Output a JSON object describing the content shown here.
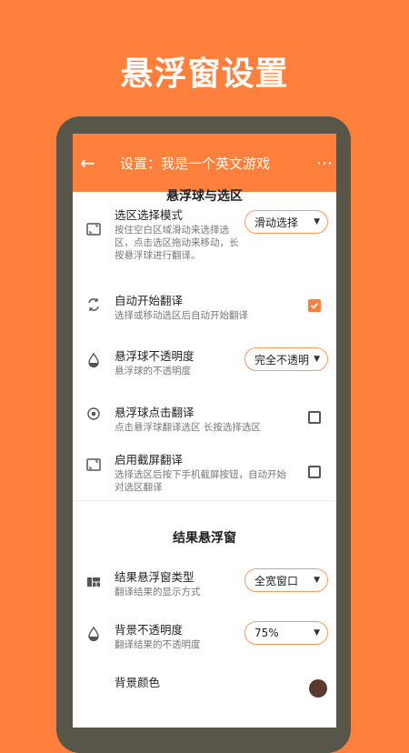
{
  "promo_title": "悬浮窗设置",
  "appbar": {
    "back_icon": "arrow-back-icon",
    "title": "设置：我是一个英文游戏",
    "more_icon": "more-icon"
  },
  "section1": {
    "title": "悬浮球与选区"
  },
  "settings1": [
    {
      "title": "选区选择模式",
      "desc": "按住空白区域滑动来选择选区，点击选区拖动来移动，长按悬浮球进行翻译。",
      "control": "dropdown",
      "value": "滑动选择"
    },
    {
      "title": "自动开始翻译",
      "desc": "选择或移动选区后自动开始翻译",
      "control": "checkbox",
      "checked": true
    },
    {
      "title": "悬浮球不透明度",
      "desc": "悬浮球的不透明度",
      "control": "dropdown",
      "value": "完全不透明"
    },
    {
      "title": "悬浮球点击翻译",
      "desc": "点击悬浮球翻译选区 长按选择选区",
      "control": "checkbox",
      "checked": false
    },
    {
      "title": "启用截屏翻译",
      "desc": "选择选区后按下手机截屏按钮，自动开始对选区翻译",
      "control": "checkbox",
      "checked": false
    }
  ],
  "section2": {
    "title": "结果悬浮窗"
  },
  "settings2": [
    {
      "title": "结果悬浮窗类型",
      "desc": "翻译结果的显示方式",
      "control": "dropdown",
      "value": "全宽窗口"
    },
    {
      "title": "背景不透明度",
      "desc": "翻译结果的不透明度",
      "control": "dropdown",
      "value": "75%"
    },
    {
      "title": "背景颜色"
    }
  ],
  "colors": {
    "accent": "#FF7F3C",
    "frame": "#575649"
  }
}
